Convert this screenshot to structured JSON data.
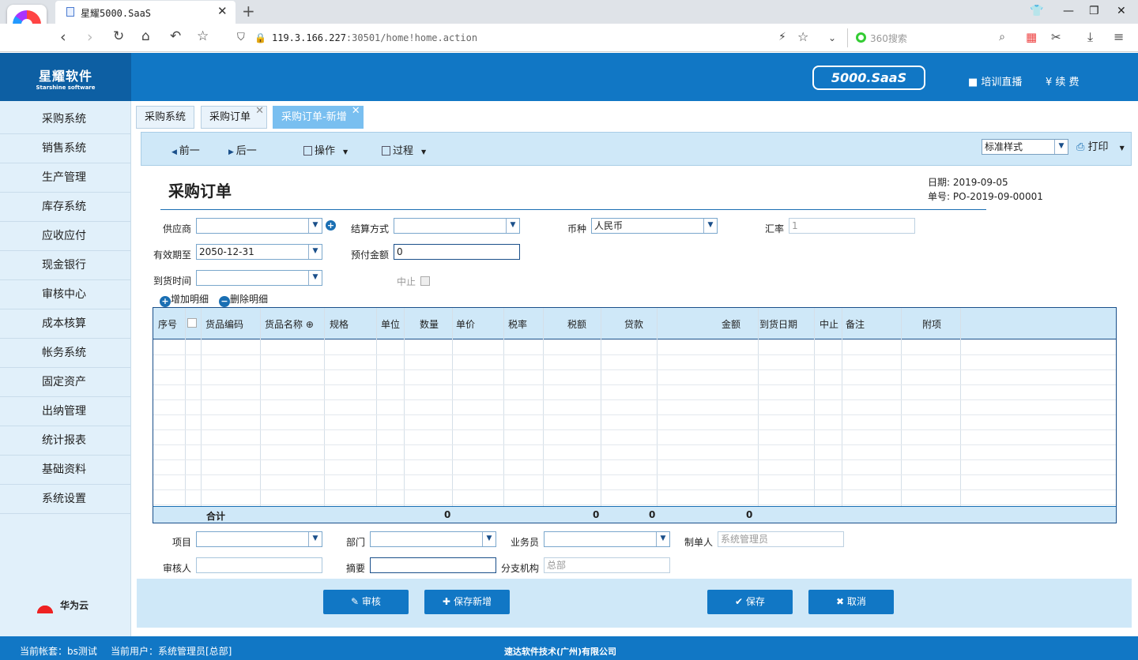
{
  "browser": {
    "tab_title": "星耀5000.SaaS",
    "url_host": "119.3.166.227",
    "url_rest": ":30501/home!home.action",
    "search_placeholder": "360搜索"
  },
  "header": {
    "brand_cn": "星耀软件",
    "brand_en": "Starshine software",
    "product": "5000.SaaS",
    "live": "培训直播",
    "renew": "续 费"
  },
  "sidebar": [
    "采购系统",
    "销售系统",
    "生产管理",
    "库存系统",
    "应收应付",
    "现金银行",
    "审核中心",
    "成本核算",
    "帐务系统",
    "固定资产",
    "出纳管理",
    "统计报表",
    "基础资料",
    "系统设置"
  ],
  "partner": "华为云",
  "tabs": [
    "采购系统",
    "采购订单",
    "采购订单-新增"
  ],
  "toolbar": {
    "prev": "前一",
    "next": "后一",
    "ops": "操作",
    "process": "过程",
    "style": "标准样式",
    "print": "打印"
  },
  "form": {
    "title": "采购订单",
    "date": "日期: 2019-09-05",
    "number": "单号: PO-2019-09-00001",
    "supplier": "供应商",
    "settle": "结算方式",
    "currency": "币种",
    "currency_val": "人民币",
    "rate": "汇率",
    "rate_val": "1",
    "valid": "有效期至",
    "valid_val": "2050-12-31",
    "prepay": "预付金额",
    "prepay_val": "0",
    "arrive": "到货时间",
    "stop": "中止",
    "add_detail": "增加明细",
    "del_detail": "删除明细"
  },
  "grid": {
    "cols": [
      "序号",
      "货品编码",
      "货品名称",
      "规格",
      "单位",
      "数量",
      "单价",
      "税率",
      "税额",
      "贷款",
      "金额",
      "到货日期",
      "中止",
      "备注",
      "附项"
    ],
    "total": "合计",
    "qty": "0",
    "tax": "0",
    "loan": "0",
    "amount": "0"
  },
  "footer_form": {
    "project": "项目",
    "dept": "部门",
    "clerk": "业务员",
    "maker": "制单人",
    "maker_val": "系统管理员",
    "auditor": "审核人",
    "summary": "摘要",
    "branch": "分支机构",
    "branch_val": "总部"
  },
  "buttons": {
    "audit": "审核",
    "save_new": "保存新增",
    "save": "保存",
    "cancel": "取消"
  },
  "status": {
    "account": "当前帐套：bs测试",
    "user": "当前用户：系统管理员[总部]",
    "company": "速达软件技术(广州)有限公司"
  }
}
